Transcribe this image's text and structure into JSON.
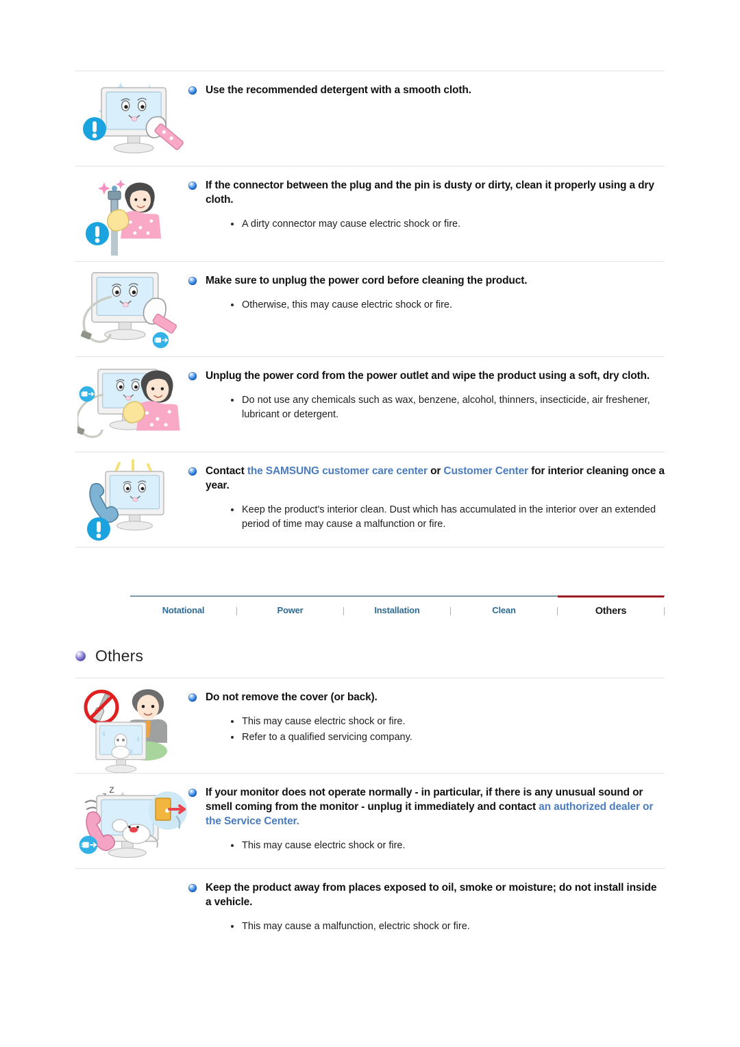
{
  "page": {
    "heading": {
      "label": "Others",
      "bullet_color": "#6f66c4"
    },
    "colors": {
      "link": "#4b7dbe",
      "bullet_blue": "#2f7fe0",
      "tab_inactive": "#2f6b92",
      "tab_active": "#1a1a1a",
      "tab_active_underline": "#9d1b23",
      "tab_rule": "#7b97a8",
      "divider": "#e3e3e3",
      "body_text": "#1d1d1d"
    }
  },
  "tabs": {
    "items": [
      {
        "label": "Notational",
        "active": false
      },
      {
        "label": "Power",
        "active": false
      },
      {
        "label": "Installation",
        "active": false
      },
      {
        "label": "Clean",
        "active": false
      },
      {
        "label": "Others",
        "active": true
      }
    ]
  },
  "clean_sections": [
    {
      "icon_name": "monitor-wipe-cloth-illustration",
      "heading_parts": [
        {
          "text": "Use the recommended detergent with a smooth cloth.",
          "link": false
        }
      ],
      "bullets": []
    },
    {
      "icon_name": "woman-cleaning-plug-illustration",
      "heading_parts": [
        {
          "text": "If the connector between the plug and the pin is dusty or dirty, clean it properly using a dry cloth.",
          "link": false
        }
      ],
      "bullets": [
        "A dirty connector may cause electric shock or fire."
      ]
    },
    {
      "icon_name": "monitor-unplug-cloth-illustration",
      "heading_parts": [
        {
          "text": "Make sure to unplug the power cord before cleaning the product.",
          "link": false
        }
      ],
      "bullets": [
        "Otherwise, this may cause electric shock or fire."
      ]
    },
    {
      "icon_name": "woman-wiping-monitor-illustration",
      "heading_parts": [
        {
          "text": "Unplug the power cord from the power outlet and wipe the product using a soft, dry cloth.",
          "link": false
        }
      ],
      "bullets": [
        "Do not use any chemicals such as wax, benzene, alcohol, thinners, insecticide, air freshener, lubricant or detergent."
      ]
    },
    {
      "icon_name": "phone-call-monitor-illustration",
      "heading_parts": [
        {
          "text": "Contact ",
          "link": false
        },
        {
          "text": "the SAMSUNG customer care center",
          "link": true
        },
        {
          "text": " or ",
          "link": false
        },
        {
          "text": "Customer Center",
          "link": true
        },
        {
          "text": " for interior cleaning once a year.",
          "link": false
        }
      ],
      "bullets": [
        "Keep the product's interior clean. Dust which has accumulated in the interior over an extended period of time may cause a malfunction or fire."
      ]
    }
  ],
  "others_sections": [
    {
      "icon_name": "no-screwdriver-open-cover-illustration",
      "heading_parts": [
        {
          "text": "Do not remove the cover (or back).",
          "link": false
        }
      ],
      "bullets": [
        "This may cause electric shock or fire.",
        "Refer to a qualified servicing company."
      ]
    },
    {
      "icon_name": "monitor-abnormal-smell-unplug-illustration",
      "heading_parts": [
        {
          "text": "If your monitor does not operate normally - in particular, if there is any unusual sound or smell coming from the monitor - unplug it immediately and contact ",
          "link": false
        },
        {
          "text": "an authorized dealer or the Service Center.",
          "link": true
        }
      ],
      "bullets": [
        "This may cause electric shock or fire."
      ]
    },
    {
      "icon_name": "no-illustration",
      "heading_parts": [
        {
          "text": "Keep the product away from places exposed to oil, smoke or moisture; do not install inside a vehicle.",
          "link": false
        }
      ],
      "bullets": [
        "This may cause a malfunction, electric shock or fire."
      ]
    }
  ]
}
